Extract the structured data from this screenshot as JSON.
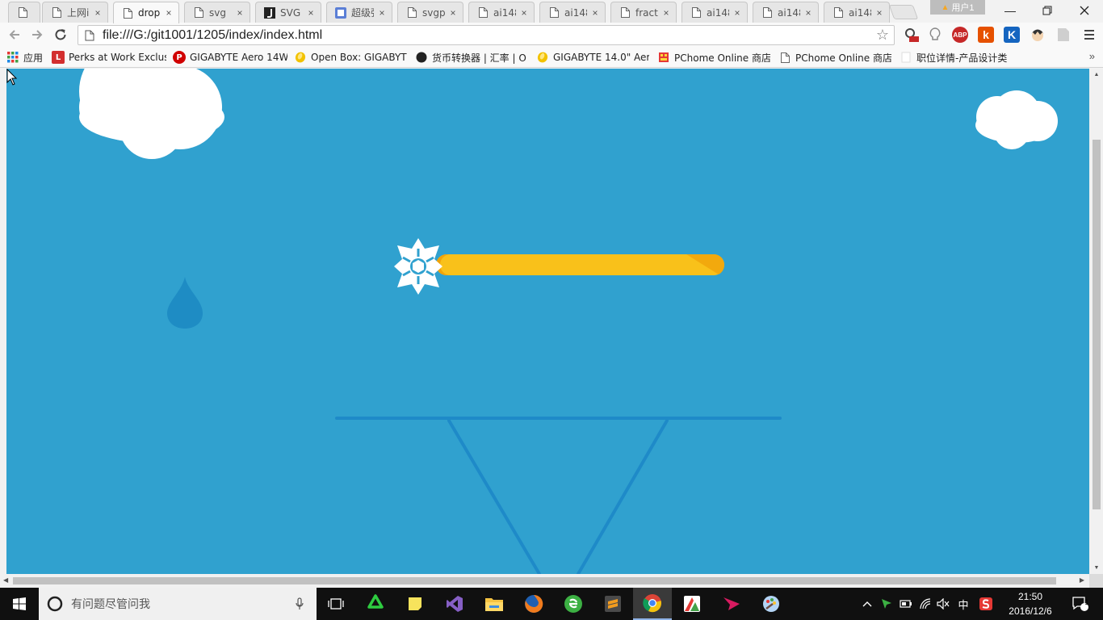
{
  "browser": {
    "tabs": [
      {
        "title": "",
        "icon": "page-icon"
      },
      {
        "title": "上网i",
        "icon": "page-icon"
      },
      {
        "title": "drop",
        "icon": "page-icon",
        "active": true
      },
      {
        "title": "svg",
        "icon": "page-icon"
      },
      {
        "title": "SVG A",
        "icon": "j-logo-icon"
      },
      {
        "title": "超级强",
        "icon": "baidu-icon"
      },
      {
        "title": "svgpa",
        "icon": "page-icon"
      },
      {
        "title": "ai148",
        "icon": "page-icon"
      },
      {
        "title": "ai148",
        "icon": "page-icon"
      },
      {
        "title": "fracta",
        "icon": "page-icon"
      },
      {
        "title": "ai148",
        "icon": "page-icon"
      },
      {
        "title": "ai148",
        "icon": "page-icon"
      },
      {
        "title": "ai148",
        "icon": "page-icon"
      }
    ],
    "tab_close_glyph": "×",
    "user_label": "用户1",
    "url": "file:///G:/git1001/1205/index/index.html",
    "extension_labels": {
      "abp": "ABP",
      "k_orange": "k",
      "k_blue": "K"
    },
    "bookmarks": [
      {
        "label": "应用",
        "icon": "apps-grid-icon"
      },
      {
        "label": "Perks at Work Exclus",
        "icon": "l-logo-icon",
        "badge": "L",
        "color": "#d32f2f"
      },
      {
        "label": "GIGABYTE Aero 14W",
        "icon": "p-logo-icon",
        "badge": "P",
        "color": "#d00000"
      },
      {
        "label": "Open Box: GIGABYT",
        "icon": "coin-icon",
        "color": "#f2c200"
      },
      {
        "label": "货币转换器 | 汇率 | O",
        "icon": "compass-icon",
        "color": "#222222"
      },
      {
        "label": "GIGABYTE 14.0\" Aer",
        "icon": "coin-icon",
        "color": "#f2c200"
      },
      {
        "label": "PChome Online 商店",
        "icon": "pchome-icon",
        "color": "#e53935"
      },
      {
        "label": "PChome Online 商店",
        "icon": "page-icon"
      },
      {
        "label": "职位详情-产品设计类",
        "icon": "blank-page-icon"
      }
    ]
  },
  "colors": {
    "canvas_bg": "#30a1cf",
    "cloud": "#ffffff",
    "drop": "#1e8cc4",
    "stand": "#1e8ac8",
    "bar": "#f9c11a",
    "bar_tip": "#f0a30a",
    "snowflake": "#ffffff"
  },
  "taskbar": {
    "search_placeholder": "有问题尽管问我",
    "ime_label": "中",
    "time": "21:50",
    "date": "2016/12/6",
    "notification_count": "1"
  }
}
